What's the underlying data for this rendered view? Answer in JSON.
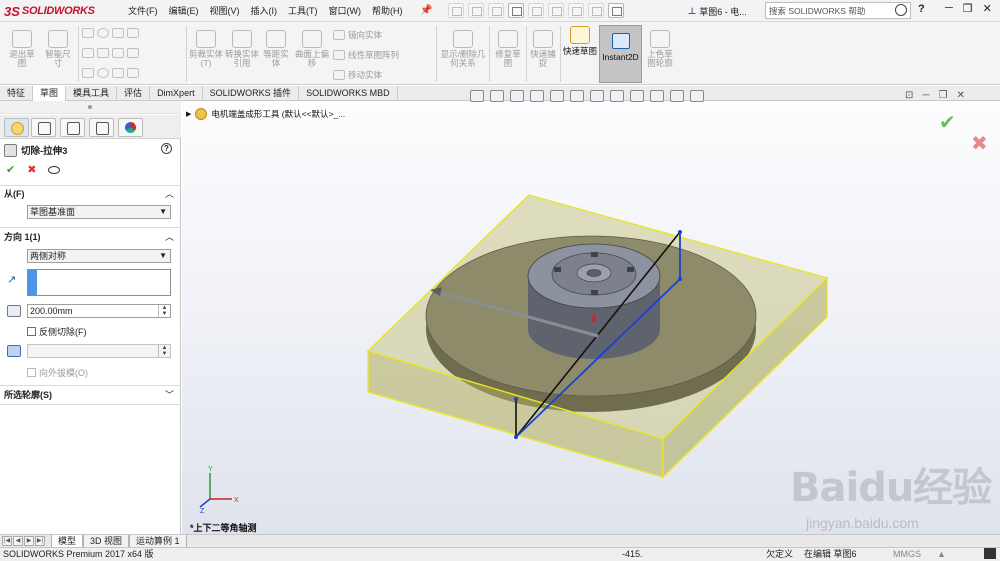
{
  "app": {
    "logo_ds": "3S",
    "logo_text": "SOLIDWORKS",
    "doc_title": "草图6 - 电...",
    "search_placeholder": "搜索 SOLIDWORKS 帮助",
    "help": "?"
  },
  "menu": [
    "文件(F)",
    "编辑(E)",
    "视图(V)",
    "插入(I)",
    "工具(T)",
    "窗口(W)",
    "帮助(H)"
  ],
  "commands": {
    "exit_sketch": "退出草图",
    "smart_dimension": "智能尺寸",
    "trim_entities": "剪裁实体(T)",
    "convert_entities": "转换实体引用",
    "offset_entities": "等距实体",
    "offset_on_surface": "曲面上偏移",
    "mirror_entities": "镜向实体",
    "linear_pattern": "线性草图阵列",
    "move_entities": "移动实体",
    "display_delete_relations": "显示/删除几何关系",
    "repair_sketch": "修复草图",
    "quick_snaps": "快速捕捉",
    "rapid_sketch": "快速草图",
    "instant2d": "Instant2D",
    "shaded_sketch": "上色草图轮廓"
  },
  "tabs": [
    "特征",
    "草图",
    "模具工具",
    "评估",
    "DimXpert",
    "SOLIDWORKS 插件",
    "SOLIDWORKS MBD"
  ],
  "active_tab": "草图",
  "property_manager": {
    "title": "切除-拉伸3",
    "ok": "✔",
    "cancel": "✖",
    "from_label": "从(F)",
    "from_value": "草图基准面",
    "direction_label": "方向 1(1)",
    "end_condition": "两侧对称",
    "depth": "200.00mm",
    "flip_side_label": "反侧切除(F)",
    "draft_outward_label": "向外拔模(O)",
    "selected_contours_label": "所选轮廓(S)"
  },
  "graphics": {
    "tree_text": "电机端盖成形工具 (默认<<默认>_...",
    "view_name": "*上下二等角轴测",
    "triad": {
      "x": "X",
      "y": "Y",
      "z": "Z"
    },
    "watermark_big": "Baidu经验",
    "watermark_small": "jingyan.baidu.com"
  },
  "bottom_tabs": [
    "模型",
    "3D 视图",
    "运动算例 1"
  ],
  "status": {
    "product": "SOLIDWORKS Premium 2017 x64 版",
    "coordinate": "-415.",
    "definition": "欠定义",
    "editing": "在编辑 草图6",
    "units": "MMGS"
  },
  "colors": {
    "brand": "#c8102e",
    "box_fill": "#b0ad5a",
    "box_edge": "#e8e626",
    "disc": "#8d8b6a",
    "hub": "#6a6e7a",
    "sketch_blue": "#1b3fd8",
    "selection_blue": "#4e95e6"
  }
}
